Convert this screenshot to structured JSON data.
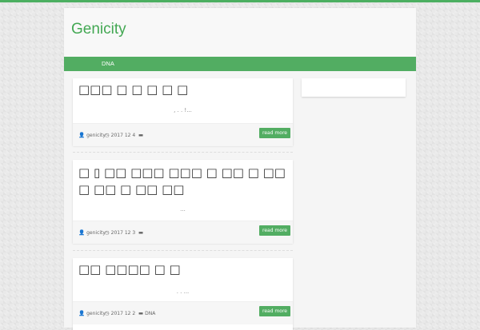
{
  "theme": {
    "accent_color": "#52ad62",
    "title_color": "#43a853"
  },
  "site": {
    "title": "Genicity"
  },
  "nav": {
    "items": [
      {
        "label": "DNA"
      }
    ]
  },
  "posts": [
    {
      "title": "□□□ □ □ □ □ □",
      "excerpt": ",   .  .                                    !...",
      "author": "genicity",
      "date": "2017  12  4",
      "category": "",
      "read_more": "read more"
    },
    {
      "title": "□ ▯ □□ □□□ □□□ □ □□ □ □□ □ □□ □ □□ □□",
      "excerpt": "...",
      "author": "genicity",
      "date": "2017  12  3",
      "category": "",
      "read_more": "read more"
    },
    {
      "title": "□□ □□□□ □ □",
      "excerpt": ".    .                                                    ...",
      "author": "genicity",
      "date": "2017  12  2",
      "category": "DNA",
      "read_more": "read more"
    }
  ],
  "icons": {
    "author": "user-icon",
    "date": "clock-icon",
    "category": "folder-icon"
  }
}
